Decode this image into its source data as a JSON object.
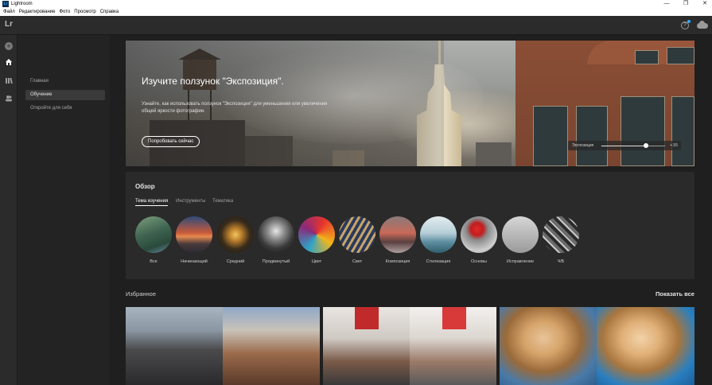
{
  "window": {
    "title": "Lightroom",
    "logo_text": "Lr",
    "controls": [
      "—",
      "❐",
      "✕"
    ]
  },
  "menu": [
    "Файл",
    "Редактирование",
    "Фото",
    "Просмотр",
    "Справка"
  ],
  "app": {
    "logo": "Lr",
    "help_icon": "help-icon",
    "cloud_icon": "cloud-sync-icon",
    "accent": "#31a8ff"
  },
  "rail": [
    "add-photo-icon",
    "home-icon",
    "library-icon",
    "people-icon"
  ],
  "subnav": {
    "items": [
      {
        "label": "Главная",
        "active": false
      },
      {
        "label": "Обучение",
        "active": true
      },
      {
        "label": "Откройте для себя",
        "active": false
      }
    ]
  },
  "hero": {
    "title": "Изучите ползунок \"Экспозиция\".",
    "description": "Узнайте, как использовать ползунок \"Экспозиция\" для уменьшения или увеличения общей яркости фотографии.",
    "button": "Попробовать сейчас",
    "slider": {
      "label": "Экспозиция",
      "value": "+.55",
      "fraction": 0.7
    }
  },
  "overview": {
    "title": "Обзор",
    "tabs": [
      {
        "label": "Тема изучения",
        "active": true
      },
      {
        "label": "Инструменты",
        "active": false
      },
      {
        "label": "Тематика",
        "active": false
      }
    ],
    "topics": [
      "Все",
      "Начинающий",
      "Средний",
      "Продвинутый",
      "Цвет",
      "Свет",
      "Композиция",
      "Стилизация",
      "Основы",
      "Исправление",
      "Ч/Б"
    ]
  },
  "featured": {
    "title": "Избранное",
    "show_all": "Показать все"
  }
}
